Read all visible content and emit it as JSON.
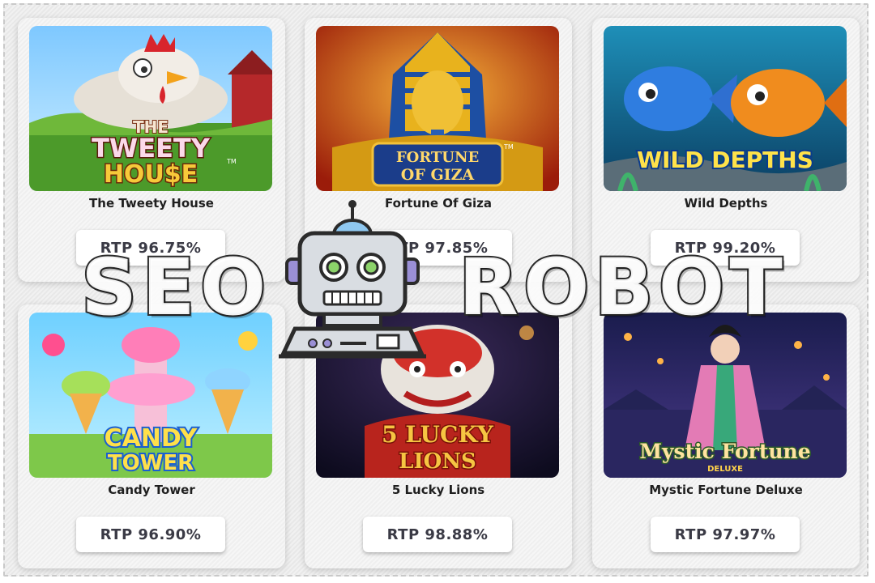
{
  "games": [
    {
      "title": "The Tweety House",
      "rtp": "RTP 96.75%",
      "logo_line1": "THE",
      "logo_line2": "TWEETY",
      "logo_line3": "HOU$E",
      "logo_tm": "TM"
    },
    {
      "title": "Fortune Of Giza",
      "rtp": "RTP 97.85%",
      "logo_line1": "FORTUNE",
      "logo_line2": "OF GIZA",
      "logo_tm": "TM"
    },
    {
      "title": "Wild Depths",
      "rtp": "RTP 99.20%",
      "logo_line1": "WILD DEPTHS"
    },
    {
      "title": "Candy Tower",
      "rtp": "RTP 96.90%",
      "logo_line1": "CANDY",
      "logo_line2": "TOWER"
    },
    {
      "title": "5 Lucky Lions",
      "rtp": "RTP 98.88%",
      "logo_line1": "5 LUCKY",
      "logo_line2": "LIONS"
    },
    {
      "title": "Mystic Fortune Deluxe",
      "rtp": "RTP 97.97%",
      "logo_line1": "Mystic Fortune",
      "logo_line2": "DELUXE"
    }
  ],
  "watermark": {
    "left": "SEO",
    "right": "ROBOT"
  },
  "colors": {
    "card_bg": "#f4f4f4",
    "text": "#1f1f1f",
    "rtp_text": "#3a3a45",
    "accent_purple": "#6b5fb8",
    "accent_gold": "#f2c230"
  }
}
